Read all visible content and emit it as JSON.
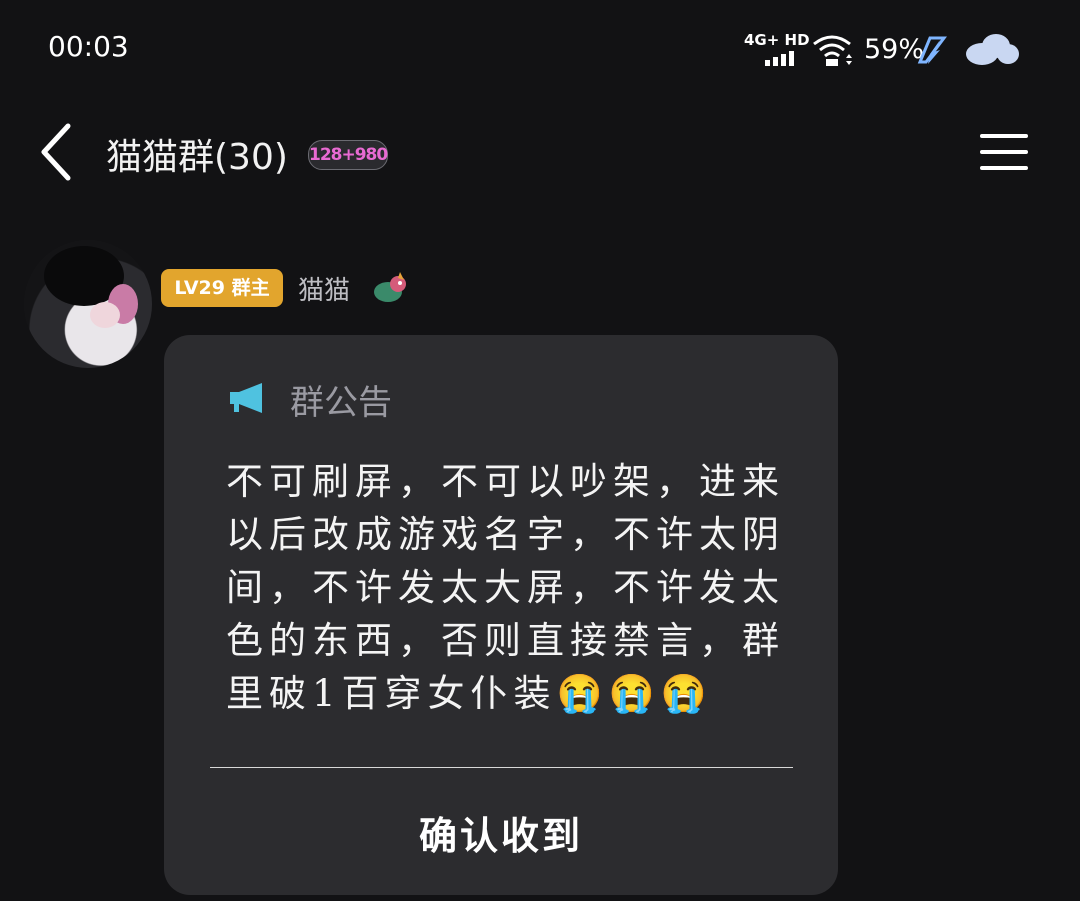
{
  "status_bar": {
    "time": "00:03",
    "network": "4G+ HD",
    "battery": "59%",
    "icons": [
      "signal-icon",
      "wifi-icon",
      "charging-icon",
      "cloud-icon"
    ]
  },
  "header": {
    "back_icon": "chevron-left-icon",
    "title": "猫猫群(30)",
    "badge": "128+980",
    "menu_icon": "hamburger-menu-icon"
  },
  "message": {
    "level_badge": "LV29 群主",
    "sender": "猫猫",
    "level_color": "#e2a52d",
    "card": {
      "title": "群公告",
      "body": "不可刷屏，不可以吵架，进来以后改成游戏名字，不许太阴间，不许发太大屏，不许发太色的东西，否则直接禁言，群里破1百穿女仆装😭😭😭",
      "confirm": "确认收到"
    }
  }
}
